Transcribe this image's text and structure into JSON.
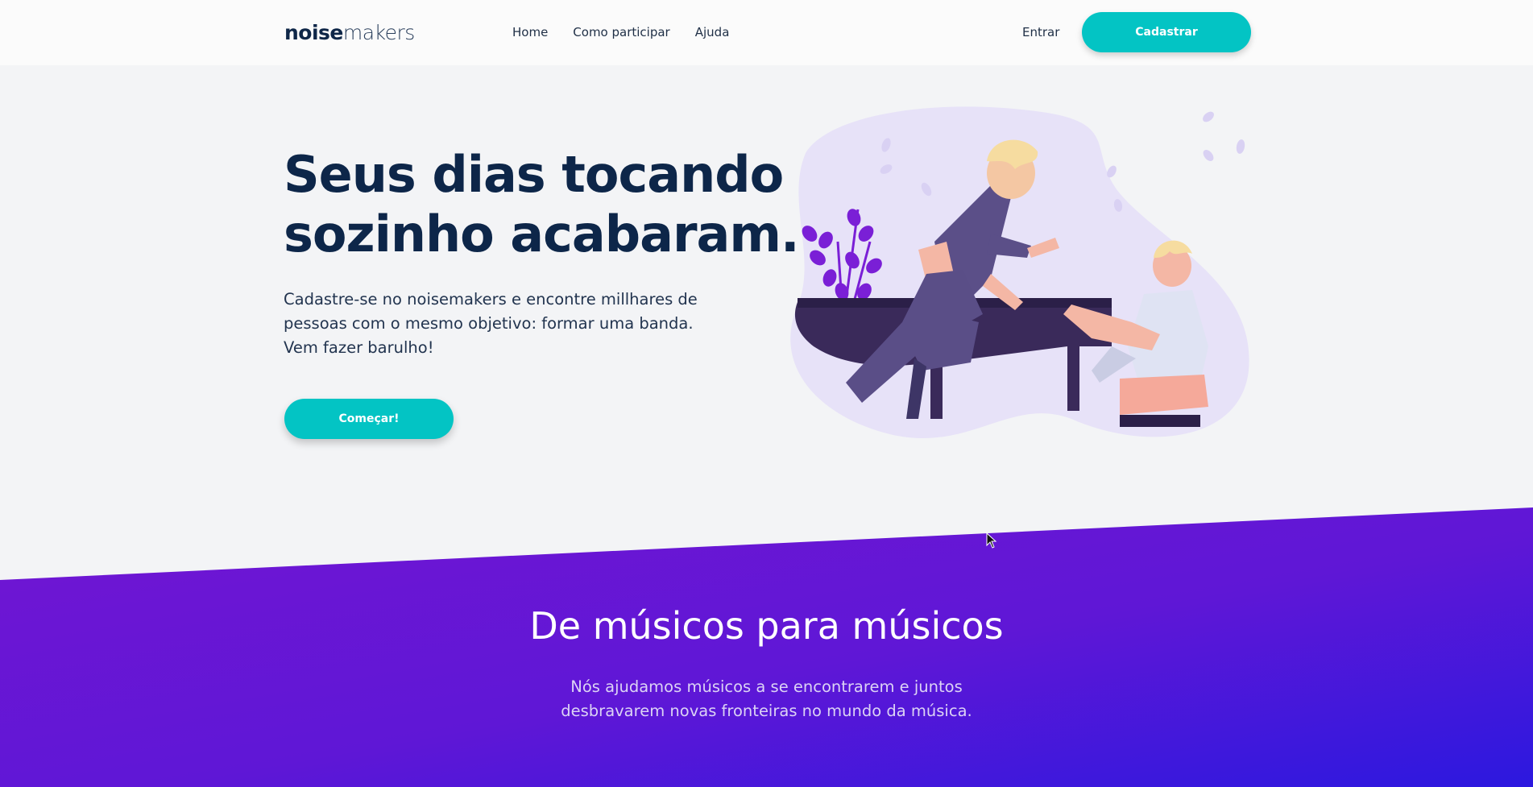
{
  "navbar": {
    "logo_bold": "noise",
    "logo_light": "makers",
    "links": [
      "Home",
      "Como participar",
      "Ajuda"
    ],
    "login": "Entrar",
    "signup": "Cadastrar"
  },
  "hero": {
    "title_line1": "Seus dias tocando",
    "title_line2": "sozinho acabaram.",
    "subtitle_line1": "Cadastre-se no noisemakers e encontre millhares de",
    "subtitle_line2": "pessoas com o mesmo objetivo: formar uma banda.",
    "subtitle_line3": "Vem fazer barulho!",
    "cta": "Começar!"
  },
  "section": {
    "title": "De músicos para músicos",
    "sub_line1": "Nós ajudamos músicos a se encontrarem e juntos",
    "sub_line2": "desbravarem novas fronteiras no mundo da música."
  },
  "colors": {
    "accent": "#03c4c4",
    "navy": "#0d2649",
    "purple_start": "#6d18d4",
    "purple_end": "#3a15dc",
    "background": "#f3f4f6"
  },
  "icons": {
    "illustration": "two-people-playing-piano-illustration",
    "cursor": "mouse-pointer-icon"
  }
}
